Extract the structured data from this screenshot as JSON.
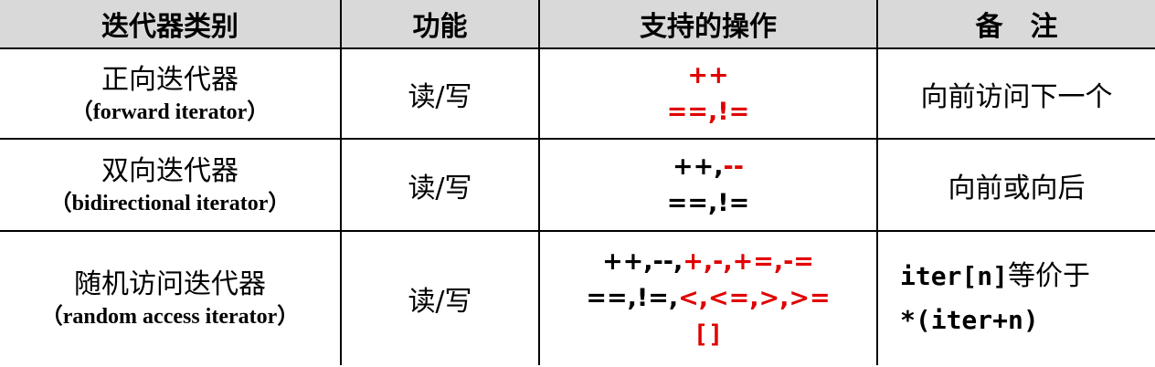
{
  "headers": [
    "迭代器类别",
    "功能",
    "支持的操作",
    "备　注"
  ],
  "rows": [
    {
      "type_cn": "正向迭代器",
      "type_en": "（forward iterator）",
      "func": "读/写",
      "ops_l1_red": "++",
      "ops_l2_red": "==,!=",
      "note": "向前访问下一个"
    },
    {
      "type_cn": "双向迭代器",
      "type_en": "（bidirectional iterator）",
      "func": "读/写",
      "ops_l1_black": "++,",
      "ops_l1_red": "--",
      "ops_l2_black": "==,!=",
      "note": "向前或向后"
    },
    {
      "type_cn": "随机访问迭代器",
      "type_en": "（random access iterator）",
      "func": "读/写",
      "ops_l1_black": "++,--,",
      "ops_l1_red": "+,-,+=,-=",
      "ops_l2_black": "==,!=,",
      "ops_l2_red": "<,<=,>,>=",
      "ops_l3_red": "[]",
      "note_l1_code": "iter[n]",
      "note_l1_text": "等价于",
      "note_l2_code": "*(iter+n)"
    }
  ],
  "colors": {
    "highlight": "#e00000",
    "header_bg": "#d9d9d9",
    "border": "#000000"
  }
}
